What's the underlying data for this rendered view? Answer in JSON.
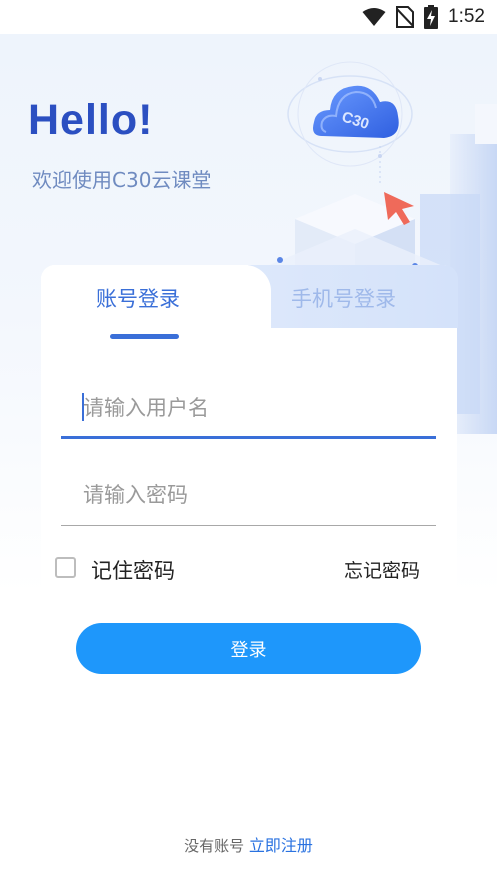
{
  "status_bar": {
    "time": "1:52",
    "icons": [
      "wifi-icon",
      "no-sim-icon",
      "battery-charging-icon"
    ]
  },
  "header": {
    "hello": "Hello!",
    "welcome": "欢迎使用C30云课堂"
  },
  "illustration": {
    "cloud_label": "C30",
    "accent_color": "#4a7cf0"
  },
  "tabs": [
    {
      "label": "账号登录",
      "active": true
    },
    {
      "label": "手机号登录",
      "active": false
    }
  ],
  "form": {
    "username_placeholder": "请输入用户名",
    "password_placeholder": "请输入密码",
    "remember_label": "记住密码",
    "remember_checked": false,
    "forgot_label": "忘记密码",
    "login_label": "登录"
  },
  "footer": {
    "no_account_text": "没有账号",
    "register_label": "立即注册"
  },
  "colors": {
    "brand_blue": "#2b4fc1",
    "accent_blue": "#3a6fd8",
    "button_blue": "#1e97fb"
  }
}
